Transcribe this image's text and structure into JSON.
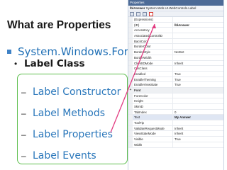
{
  "slide_title": "What are Properties",
  "tree": {
    "namespace": "System.Windows.Forms",
    "class": "Label Class",
    "members": [
      "Label Constructor",
      "Label Methods",
      "Label Properties",
      "Label Events"
    ]
  },
  "properties_window": {
    "title": "Properties",
    "object_name": "lblAnswer",
    "object_type": "System.Web.UI.WebControls.Label",
    "rows": [
      {
        "name": "(Expressions)",
        "value": "",
        "category": false
      },
      {
        "name": "(ID)",
        "value": "lblAnswer",
        "category": false,
        "bold": true
      },
      {
        "name": "AccessKey",
        "value": "",
        "category": false
      },
      {
        "name": "AssociatedControlID",
        "value": "",
        "category": false
      },
      {
        "name": "BackColor",
        "value": "",
        "category": false
      },
      {
        "name": "BorderColor",
        "value": "",
        "category": false
      },
      {
        "name": "BorderStyle",
        "value": "NotSet",
        "category": false
      },
      {
        "name": "BorderWidth",
        "value": "",
        "category": false
      },
      {
        "name": "ClientIDMode",
        "value": "Inherit",
        "category": false
      },
      {
        "name": "CssClass",
        "value": "",
        "category": false
      },
      {
        "name": "Enabled",
        "value": "True",
        "category": false
      },
      {
        "name": "EnableTheming",
        "value": "True",
        "category": false
      },
      {
        "name": "EnableViewState",
        "value": "True",
        "category": false
      },
      {
        "name": "Font",
        "value": "",
        "category": true
      },
      {
        "name": "ForeColor",
        "value": "",
        "category": false
      },
      {
        "name": "Height",
        "value": "",
        "category": false
      },
      {
        "name": "SkinID",
        "value": "",
        "category": false
      },
      {
        "name": "TabIndex",
        "value": "0",
        "category": false
      },
      {
        "name": "Text",
        "value": "My Answer",
        "category": false,
        "selected": true,
        "bold": true
      },
      {
        "name": "ToolTip",
        "value": "",
        "category": false
      },
      {
        "name": "ValidateRequestMode",
        "value": "Inherit",
        "category": false
      },
      {
        "name": "ViewStateMode",
        "value": "Inherit",
        "category": false
      },
      {
        "name": "Visible",
        "value": "True",
        "category": false
      },
      {
        "name": "Width",
        "value": "",
        "category": false
      }
    ]
  },
  "colors": {
    "title_bar": "#4d6b97",
    "namespace_text": "#1f6fb5",
    "member_text": "#2a77bb",
    "highlight_box": "#5fbf4f",
    "arrow": "#e23a80",
    "toolbar_highlight": "#d8342c"
  }
}
